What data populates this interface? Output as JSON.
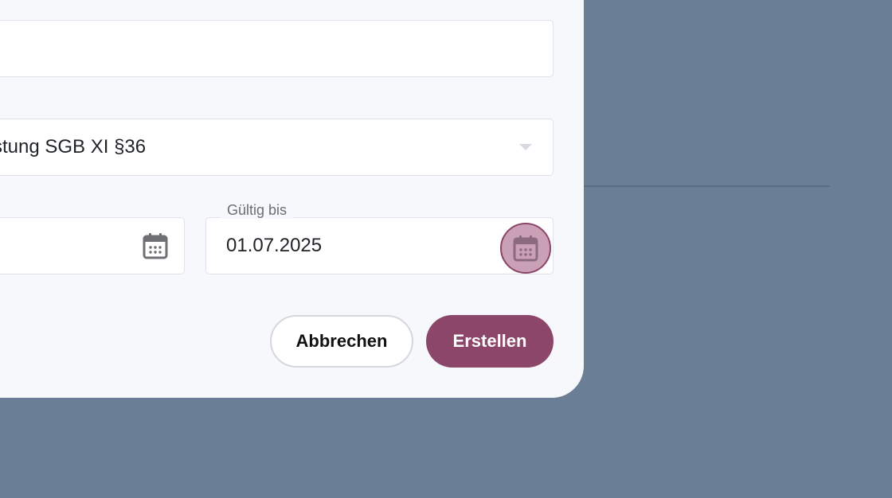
{
  "dialog": {
    "top_field": {
      "value": ""
    },
    "service_select": {
      "value": "stung SGB XI §36",
      "chevron_icon": "chevron-down-icon"
    },
    "valid_from": {
      "value": "",
      "calendar_icon": "calendar-icon"
    },
    "valid_to": {
      "label": "Gültig bis",
      "value": "01.07.2025",
      "calendar_icon": "calendar-icon",
      "calendar_active": true
    },
    "buttons": {
      "cancel_label": "Abbrechen",
      "create_label": "Erstellen"
    }
  },
  "colors": {
    "backdrop": "#6a7f95",
    "dialog_bg": "#f7f8fc",
    "accent": "#8c4669",
    "accent_light": "#c9a0b6",
    "field_border": "#dfe2ea"
  }
}
